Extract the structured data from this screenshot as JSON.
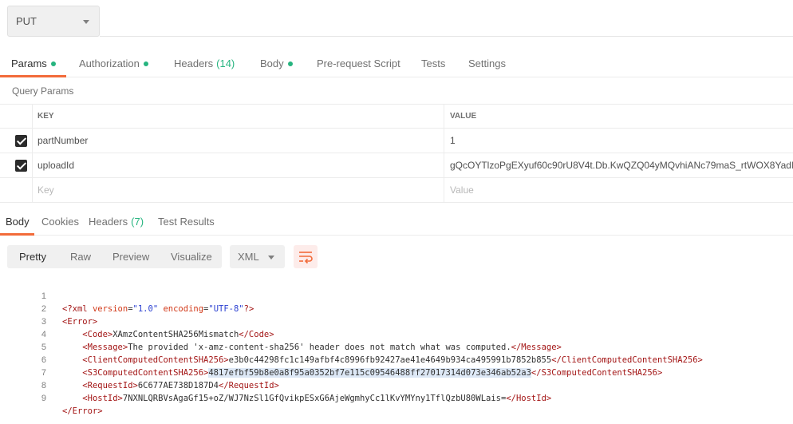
{
  "request": {
    "method": "PUT"
  },
  "request_tabs": [
    {
      "label": "Params",
      "dot": true,
      "count": ""
    },
    {
      "label": "Authorization",
      "dot": true,
      "count": ""
    },
    {
      "label": "Headers",
      "dot": false,
      "count": "(14)"
    },
    {
      "label": "Body",
      "dot": true,
      "count": ""
    },
    {
      "label": "Pre-request Script",
      "dot": false,
      "count": ""
    },
    {
      "label": "Tests",
      "dot": false,
      "count": ""
    },
    {
      "label": "Settings",
      "dot": false,
      "count": ""
    }
  ],
  "query_params": {
    "title": "Query Params",
    "key_header": "KEY",
    "value_header": "VALUE",
    "rows": [
      {
        "key": "partNumber",
        "value": "1",
        "checked": true
      },
      {
        "key": "uploadId",
        "value": "gQcOYTlzoPgEXyuf60c90rU8V4t.Db.KwQZQ04yMQvhiANc79maS_rtWOX8YadI",
        "checked": true
      }
    ],
    "key_placeholder": "Key",
    "value_placeholder": "Value"
  },
  "response_tabs": [
    {
      "label": "Body",
      "count": ""
    },
    {
      "label": "Cookies",
      "count": ""
    },
    {
      "label": "Headers",
      "count": "(7)"
    },
    {
      "label": "Test Results",
      "count": ""
    }
  ],
  "format": {
    "buttons": [
      "Pretty",
      "Raw",
      "Preview",
      "Visualize"
    ],
    "language": "XML"
  },
  "code": {
    "line_numbers": [
      "1",
      "2",
      "3",
      "4",
      "5",
      "6",
      "7",
      "8",
      "9"
    ],
    "decl": {
      "open": "<?xml",
      "a1": "version",
      "v1": "\"1.0\"",
      "a2": "encoding",
      "v2": "\"UTF-8\"",
      "close": "?>"
    },
    "error_open": "<Error>",
    "code_open": "<Code>",
    "code_text": "XAmzContentSHA256Mismatch",
    "code_close": "</Code>",
    "message_open": "<Message>",
    "message_text": "The provided 'x-amz-content-sha256' header does not match what was computed.",
    "message_close": "</Message>",
    "client_open": "<ClientComputedContentSHA256>",
    "client_text": "e3b0c44298fc1c149afbf4c8996fb92427ae41e4649b934ca495991b7852b855",
    "client_close": "</ClientComputedContentSHA256>",
    "s3_open": "<S3ComputedContentSHA256>",
    "s3_text": "4817efbf59b8e0a8f95a0352bf7e115c09546488ff27017314d073e346ab52a3",
    "s3_close": "</S3ComputedContentSHA256>",
    "reqid_open": "<RequestId>",
    "reqid_text": "6C677AE738D187D4",
    "reqid_close": "</RequestId>",
    "hostid_open": "<HostId>",
    "hostid_text": "7NXNLQRBVsAgaGf15+oZ/WJ7NzSl1GfQvikpESxG6AjeWgmhyCc1lKvYMYny1TflQzbU80WLais=",
    "hostid_close": "</HostId>",
    "error_close": "</Error>"
  },
  "colors": {
    "accent": "#f26b3a",
    "dot": "#26b47f"
  }
}
